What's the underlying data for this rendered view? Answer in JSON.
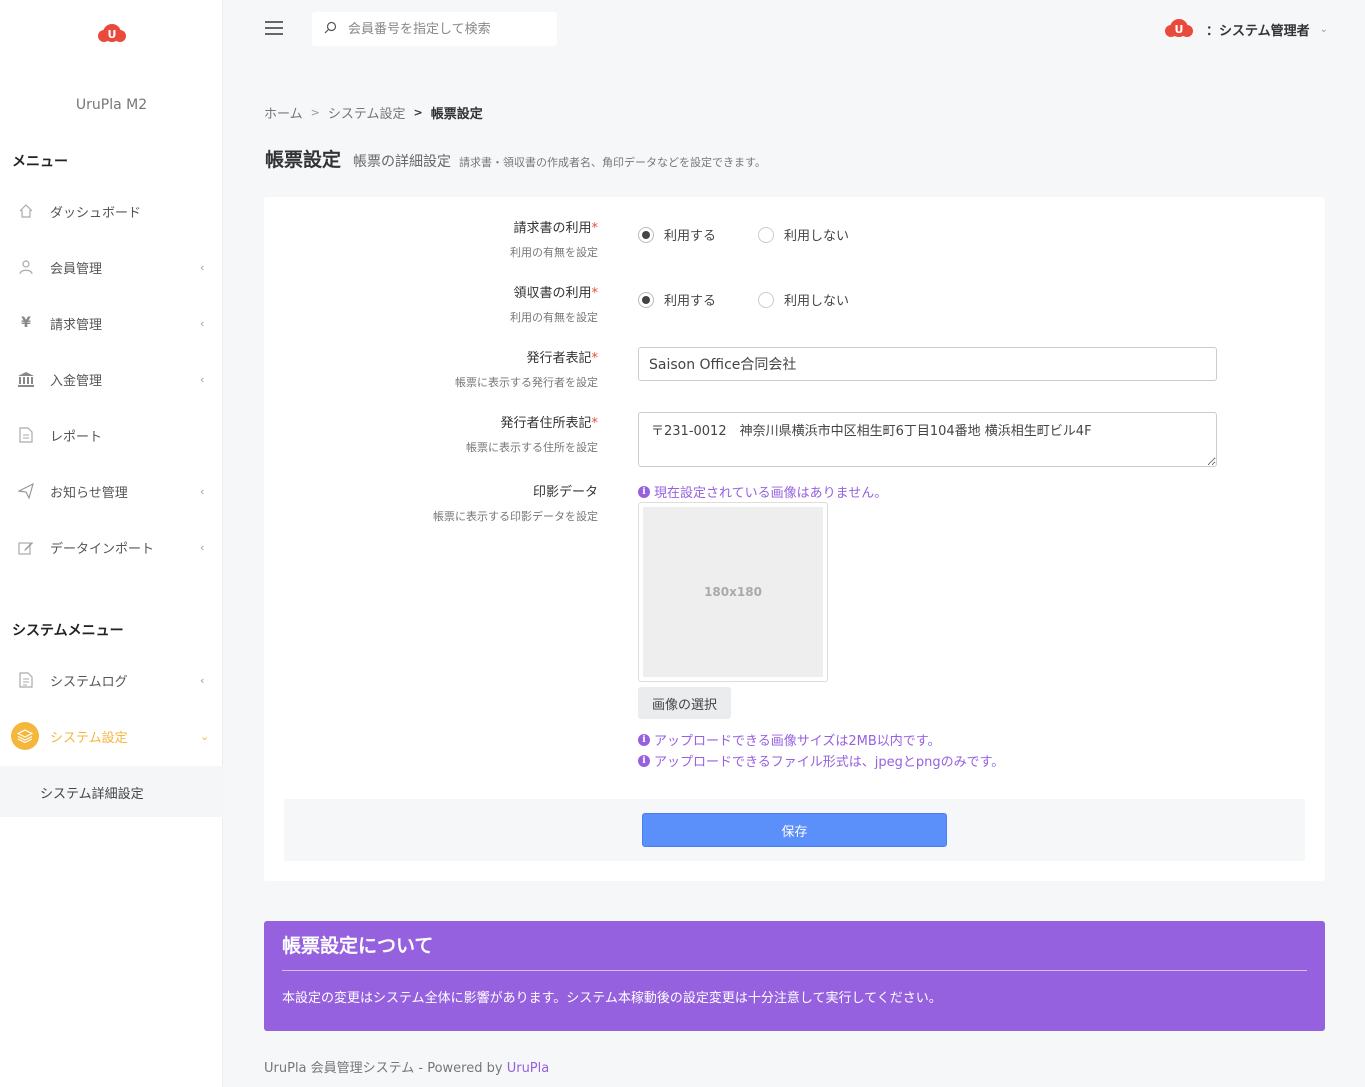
{
  "sidebar": {
    "app_name": "UruPla M2",
    "menu_heading": "メニュー",
    "items": [
      {
        "label": "ダッシュボード",
        "icon": "home-icon"
      },
      {
        "label": "会員管理",
        "icon": "user-icon"
      },
      {
        "label": "請求管理",
        "icon": "yen-icon"
      },
      {
        "label": "入金管理",
        "icon": "bank-icon"
      },
      {
        "label": "レポート",
        "icon": "document-icon"
      },
      {
        "label": "お知らせ管理",
        "icon": "paper-plane-icon"
      },
      {
        "label": "データインポート",
        "icon": "edit-icon"
      }
    ],
    "system_heading": "システムメニュー",
    "system_items": [
      {
        "label": "システムログ",
        "icon": "log-icon"
      },
      {
        "label": "システム設定",
        "icon": "layers-icon"
      }
    ],
    "submenu_item": "システム詳細設定",
    "active_color": "#f5b63c"
  },
  "topbar": {
    "search_placeholder": "会員番号を指定して検索",
    "user_label": "：システム管理者"
  },
  "breadcrumb": {
    "home": "ホーム",
    "parent": "システム設定",
    "current": "帳票設定"
  },
  "page_title": {
    "title": "帳票設定",
    "subtitle": "帳票の詳細設定",
    "description": "請求書・領収書の作成者名、角印データなどを設定できます。"
  },
  "form": {
    "invoice": {
      "label": "請求書の利用",
      "required": "*",
      "sub": "利用の有無を設定",
      "opt_use": "利用する",
      "opt_nouse": "利用しない"
    },
    "receipt": {
      "label": "領収書の利用",
      "required": "*",
      "sub": "利用の有無を設定",
      "opt_use": "利用する",
      "opt_nouse": "利用しない"
    },
    "issuer": {
      "label": "発行者表記",
      "required": "*",
      "sub": "帳票に表示する発行者を設定",
      "value": "Saison Office合同会社"
    },
    "address": {
      "label": "発行者住所表記",
      "required": "*",
      "sub": "帳票に表示する住所を設定",
      "value": "〒231-0012　神奈川県横浜市中区相生町6丁目104番地 横浜相生町ビル4F"
    },
    "seal": {
      "label": "印影データ",
      "sub": "帳票に表示する印影データを設定",
      "notice_none": "現在設定されている画像はありません。",
      "placeholder": "180x180",
      "select_button": "画像の選択",
      "notice_size": "アップロードできる画像サイズは2MB以内です。",
      "notice_format": "アップロードできるファイル形式は、jpegとpngのみです。"
    },
    "save_button": "保存"
  },
  "info": {
    "title": "帳票設定について",
    "text": "本設定の変更はシステム全体に影響があります。システム本稼動後の設定変更は十分注意して実行してください。",
    "color": "#9661df"
  },
  "footer": {
    "text": "UruPla 会員管理システム - Powered by ",
    "link": "UruPla"
  }
}
